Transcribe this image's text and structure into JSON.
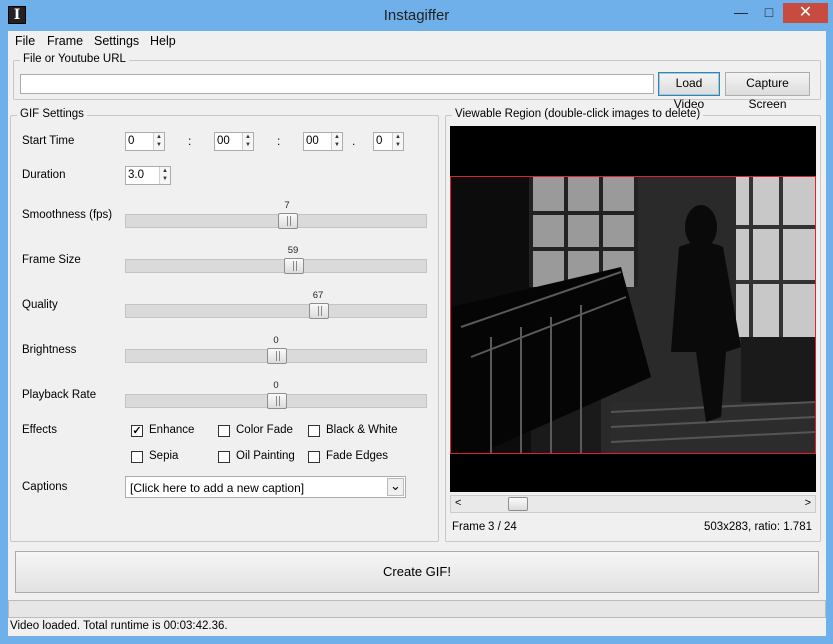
{
  "window": {
    "title": "Instagiffer",
    "app_icon_glyph": "I",
    "minimize_glyph": "—",
    "maximize_glyph": "□",
    "close_glyph": "✕"
  },
  "menu": [
    "File",
    "Frame",
    "Settings",
    "Help"
  ],
  "source": {
    "legend": "File or Youtube URL",
    "url_value": "",
    "url_placeholder": "",
    "load_label": "Load Video",
    "capture_label": "Capture Screen"
  },
  "gif": {
    "legend": "GIF Settings",
    "start_time": {
      "label": "Start Time",
      "hours": "0",
      "minutes": "00",
      "seconds": "00",
      "fraction": "0",
      "sep1": ":",
      "sep2": ":",
      "sep3": "."
    },
    "duration": {
      "label": "Duration",
      "value": "3.0"
    },
    "sliders": [
      {
        "label": "Smoothness (fps)",
        "value": "7",
        "fraction": 0.54
      },
      {
        "label": "Frame Size",
        "value": "59",
        "fraction": 0.56
      },
      {
        "label": "Quality",
        "value": "67",
        "fraction": 0.65
      },
      {
        "label": "Brightness",
        "value": "0",
        "fraction": 0.5
      },
      {
        "label": "Playback Rate",
        "value": "0",
        "fraction": 0.5
      }
    ],
    "effects_label": "Effects",
    "effects": [
      {
        "label": "Enhance",
        "checked": true,
        "check_glyph": "✓"
      },
      {
        "label": "Color Fade",
        "checked": false,
        "check_glyph": ""
      },
      {
        "label": "Black & White",
        "checked": false,
        "check_glyph": ""
      },
      {
        "label": "Sepia",
        "checked": false,
        "check_glyph": ""
      },
      {
        "label": "Oil Painting",
        "checked": false,
        "check_glyph": ""
      },
      {
        "label": "Fade Edges",
        "checked": false,
        "check_glyph": ""
      }
    ],
    "captions": {
      "label": "Captions",
      "selected": "[Click here to add a new caption]",
      "dropdown_glyph": "⌄"
    }
  },
  "viewer": {
    "legend": "Viewable Region (double-click images to delete)",
    "frame_label": "Frame",
    "frame_value": "3 / 24",
    "frame_fraction": 0.125,
    "dimensions": "503x283, ratio: 1.781",
    "scroll_left_glyph": "<",
    "scroll_right_glyph": ">"
  },
  "create_label": "Create GIF!",
  "status": "Video loaded. Total runtime is 00:03:42.36."
}
